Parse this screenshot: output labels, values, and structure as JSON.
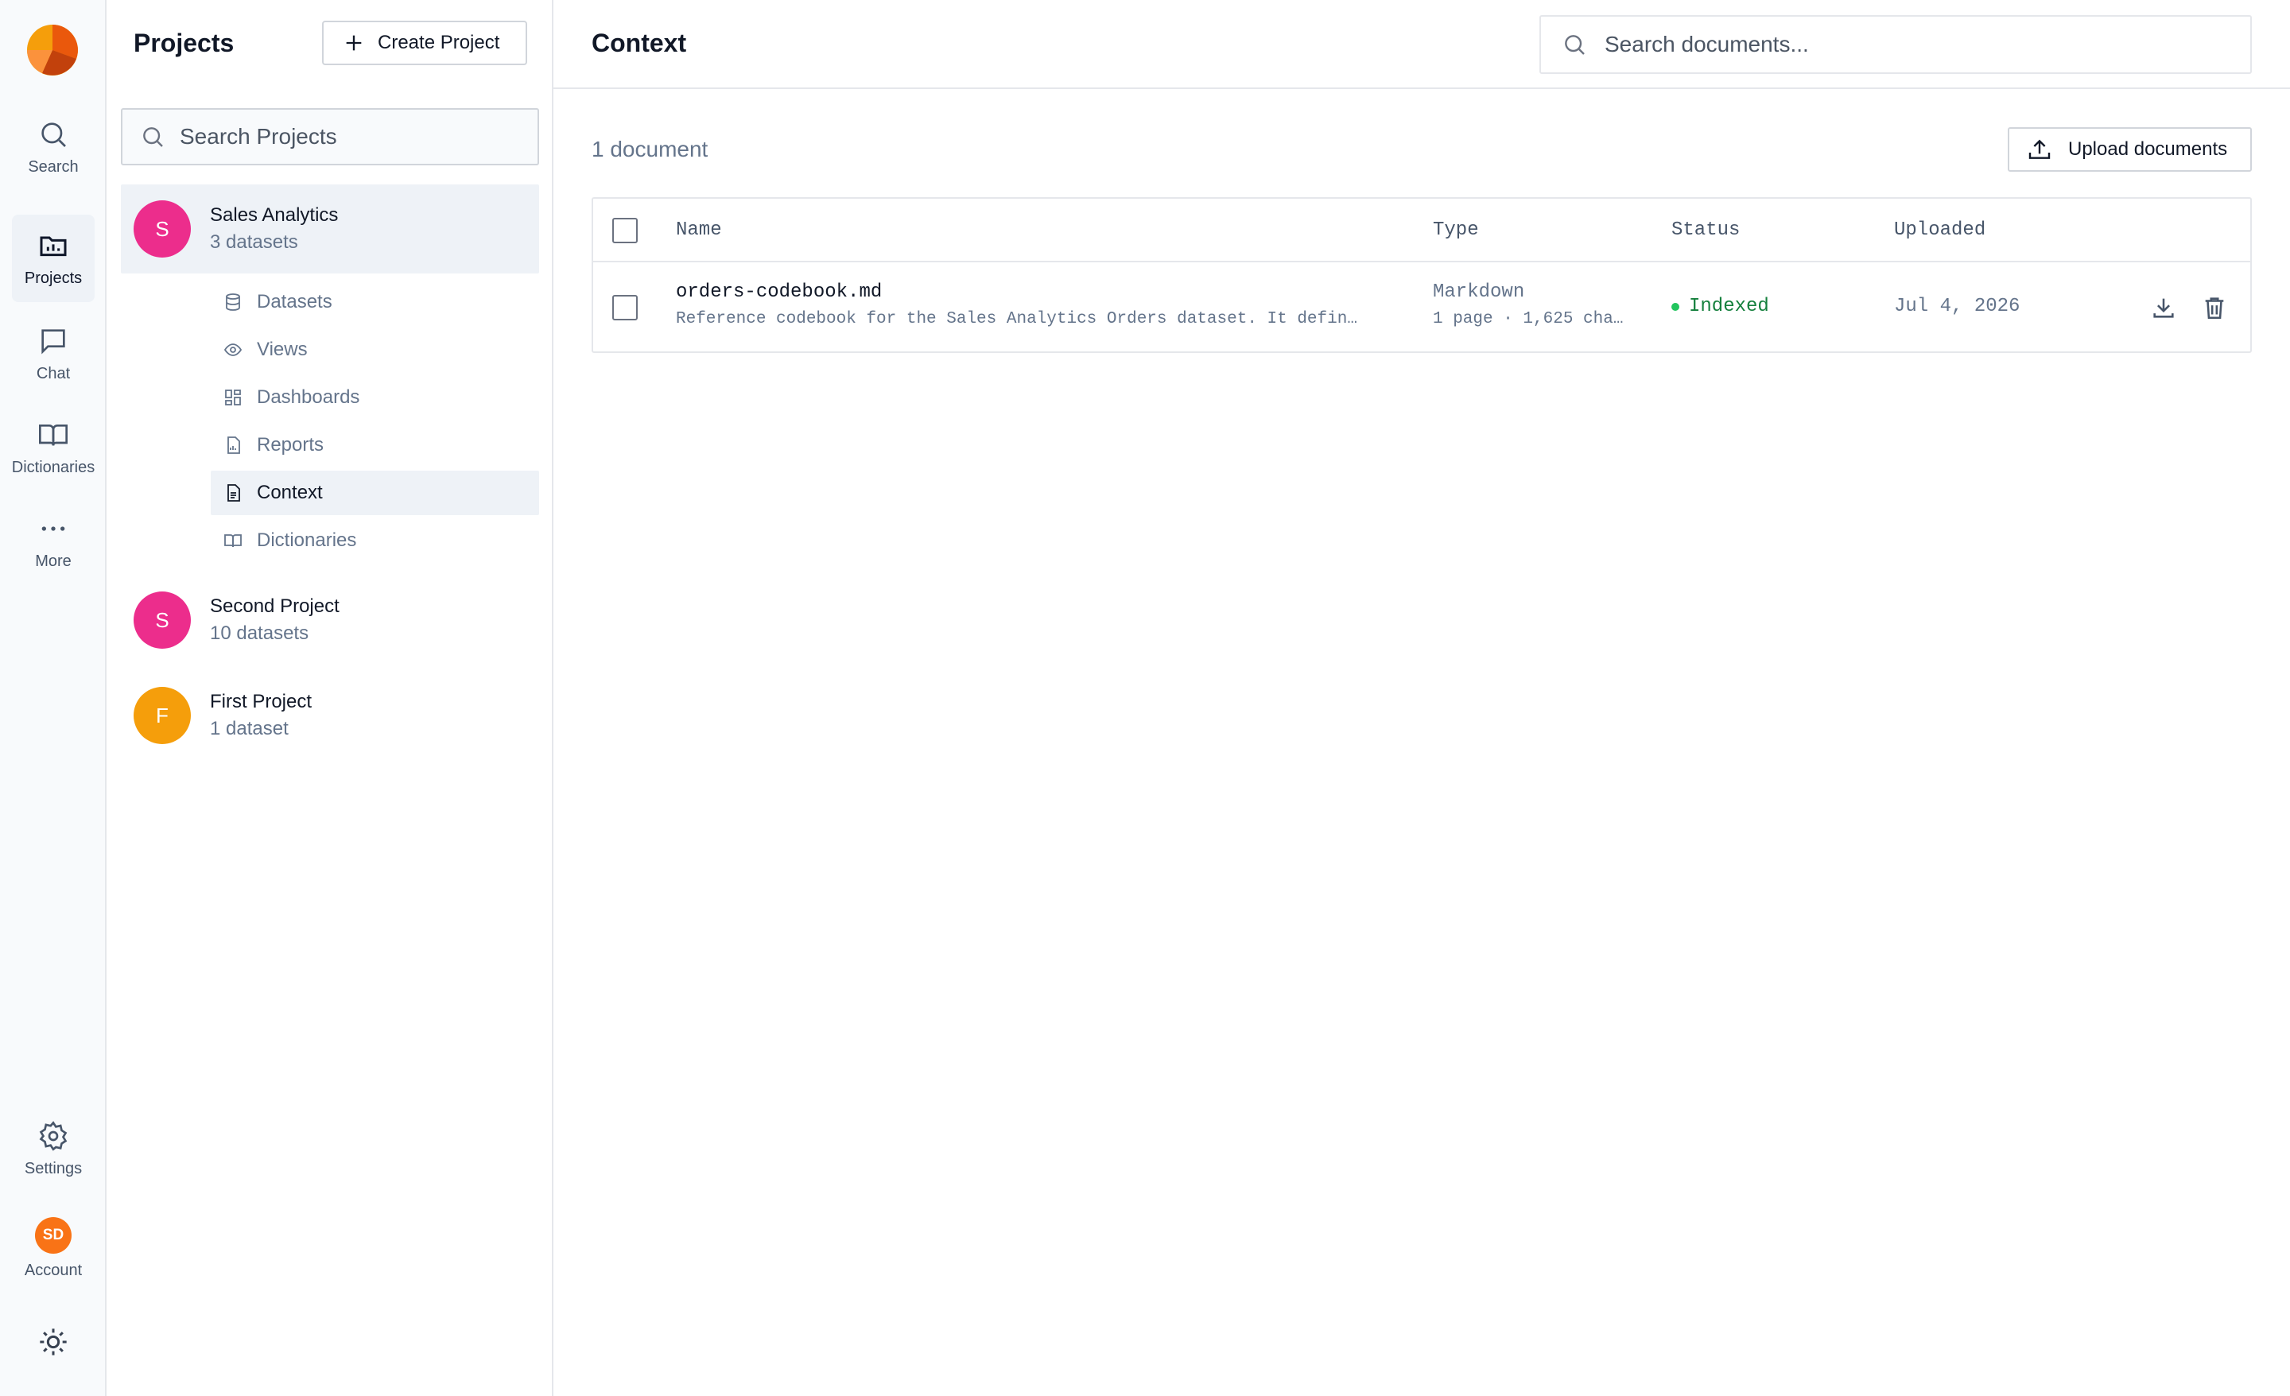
{
  "rail": {
    "items": [
      {
        "label": "Search",
        "icon": "search-icon"
      },
      {
        "label": "Projects",
        "icon": "folder-icon"
      },
      {
        "label": "Chat",
        "icon": "chat-icon"
      },
      {
        "label": "Dictionaries",
        "icon": "book-icon"
      },
      {
        "label": "More",
        "icon": "more-icon"
      }
    ],
    "settings_label": "Settings",
    "account_label": "Account",
    "account_initials": "SD"
  },
  "projects_panel": {
    "title": "Projects",
    "create_label": "Create Project",
    "search_placeholder": "Search Projects",
    "projects": [
      {
        "initial": "S",
        "name": "Sales Analytics",
        "sub": "3 datasets",
        "color": "#ec2d8c"
      },
      {
        "initial": "S",
        "name": "Second Project",
        "sub": "10 datasets",
        "color": "#ec2d8c"
      },
      {
        "initial": "F",
        "name": "First Project",
        "sub": "1 dataset",
        "color": "#f59e0b"
      }
    ],
    "sub_items": [
      {
        "label": "Datasets",
        "icon": "database-icon"
      },
      {
        "label": "Views",
        "icon": "eye-icon"
      },
      {
        "label": "Dashboards",
        "icon": "dashboard-icon"
      },
      {
        "label": "Reports",
        "icon": "report-icon"
      },
      {
        "label": "Context",
        "icon": "document-icon"
      },
      {
        "label": "Dictionaries",
        "icon": "book-icon"
      }
    ]
  },
  "main": {
    "title": "Context",
    "search_placeholder": "Search documents...",
    "count": "1 document",
    "upload_label": "Upload documents",
    "columns": {
      "name": "Name",
      "type": "Type",
      "status": "Status",
      "uploaded": "Uploaded"
    },
    "rows": [
      {
        "name": "orders-codebook.md",
        "description": "Reference codebook for the Sales Analytics Orders dataset. It defin…",
        "type": "Markdown",
        "type_detail": "1 page · 1,625 cha…",
        "status": "Indexed",
        "uploaded": "Jul 4, 2026"
      }
    ]
  }
}
